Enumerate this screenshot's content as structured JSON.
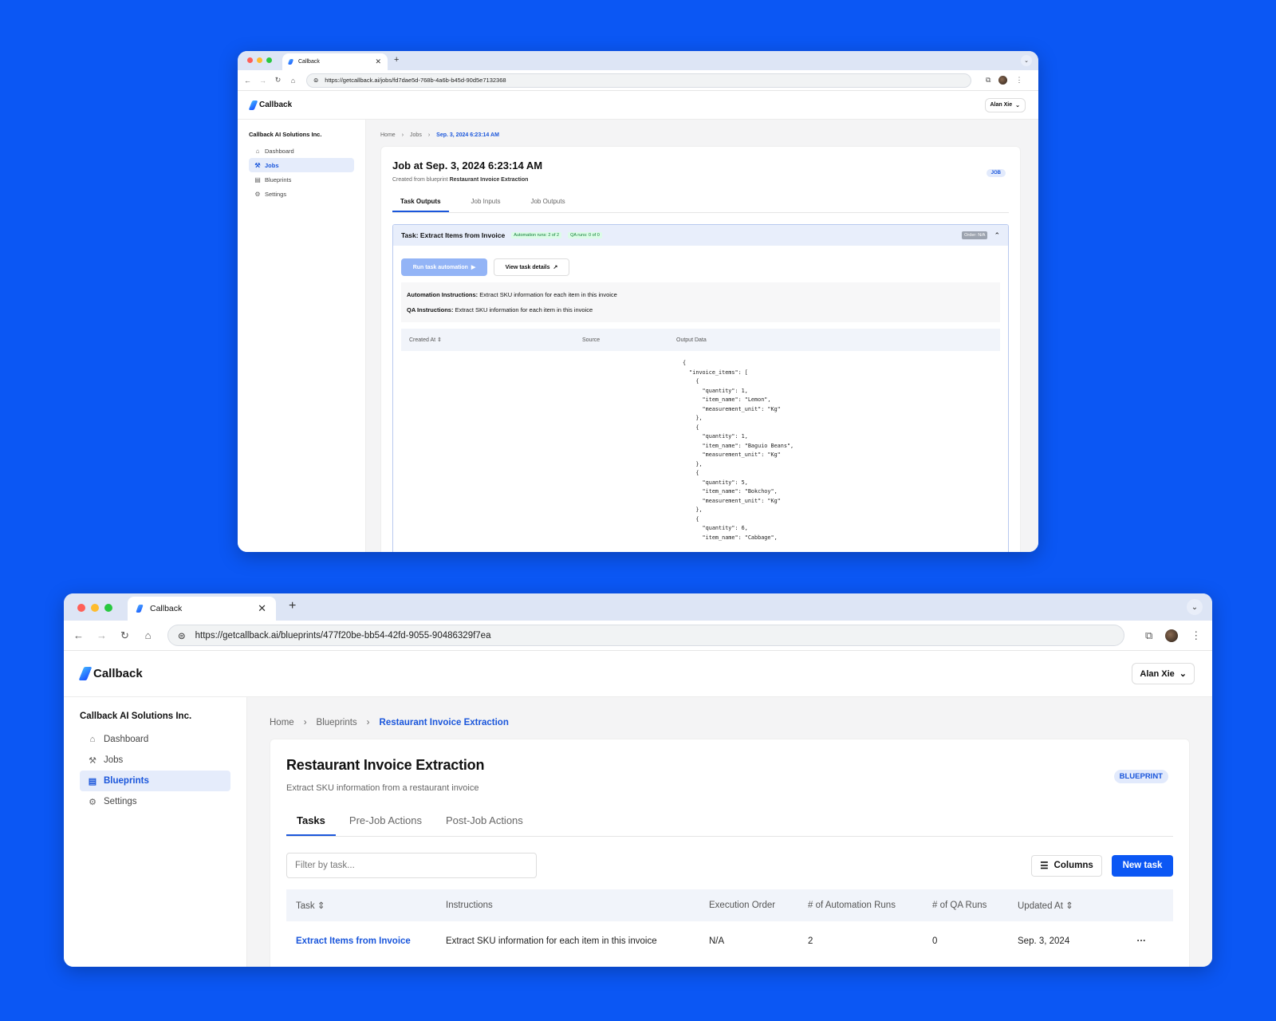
{
  "window1": {
    "tab_title": "Callback",
    "url": "https://getcallback.ai/jobs/fd7dae5d-768b-4a6b-b45d-90d5e7132368",
    "logo_text": "Callback",
    "user_name": "Alan Xie",
    "org_name": "Callback AI Solutions Inc.",
    "nav": [
      {
        "label": "Dashboard",
        "icon": "home-icon"
      },
      {
        "label": "Jobs",
        "icon": "hammer-icon",
        "active": true
      },
      {
        "label": "Blueprints",
        "icon": "blueprint-icon"
      },
      {
        "label": "Settings",
        "icon": "gear-icon"
      }
    ],
    "breadcrumbs": [
      "Home",
      "Jobs",
      "Sep. 3, 2024 6:23:14 AM"
    ],
    "title": "Job at Sep. 3, 2024 6:23:14 AM",
    "subtitle_prefix": "Created from blueprint",
    "subtitle_blueprint": "Restaurant Invoice Extraction",
    "badge": "JOB",
    "tabs": [
      "Task Outputs",
      "Job Inputs",
      "Job Outputs"
    ],
    "task": {
      "name": "Task: Extract Items from Invoice",
      "automation_runs": "Automation runs: 2 of 2",
      "qa_runs": "QA runs: 0 of 0",
      "order": "Order: N/A",
      "run_button": "Run task automation",
      "details_button": "View task details",
      "automation_label": "Automation Instructions:",
      "automation_text": "Extract SKU information for each item in this invoice",
      "qa_label": "QA Instructions:",
      "qa_text": "Extract SKU information for each item in this invoice",
      "columns": [
        "Created At",
        "Source",
        "Output Data"
      ],
      "output_json": "{\n  \"invoice_items\": [\n    {\n      \"quantity\": 1,\n      \"item_name\": \"Lemon\",\n      \"measurement_unit\": \"Kg\"\n    },\n    {\n      \"quantity\": 1,\n      \"item_name\": \"Baguio Beans\",\n      \"measurement_unit\": \"Kg\"\n    },\n    {\n      \"quantity\": 5,\n      \"item_name\": \"Bokchoy\",\n      \"measurement_unit\": \"Kg\"\n    },\n    {\n      \"quantity\": 6,\n      \"item_name\": \"Cabbage\","
    }
  },
  "window2": {
    "tab_title": "Callback",
    "url": "https://getcallback.ai/blueprints/477f20be-bb54-42fd-9055-90486329f7ea",
    "logo_text": "Callback",
    "user_name": "Alan Xie",
    "org_name": "Callback AI Solutions Inc.",
    "nav": [
      {
        "label": "Dashboard",
        "icon": "home-icon"
      },
      {
        "label": "Jobs",
        "icon": "hammer-icon"
      },
      {
        "label": "Blueprints",
        "icon": "blueprint-icon",
        "active": true
      },
      {
        "label": "Settings",
        "icon": "gear-icon"
      }
    ],
    "breadcrumbs": [
      "Home",
      "Blueprints",
      "Restaurant Invoice Extraction"
    ],
    "title": "Restaurant Invoice Extraction",
    "subtitle": "Extract SKU information from a restaurant invoice",
    "badge": "BLUEPRINT",
    "tabs": [
      "Tasks",
      "Pre-Job Actions",
      "Post-Job Actions"
    ],
    "filter_placeholder": "Filter by task...",
    "columns_button": "Columns",
    "new_task_button": "New task",
    "table": {
      "columns": [
        "Task",
        "Instructions",
        "Execution Order",
        "# of Automation Runs",
        "# of QA Runs",
        "Updated At"
      ],
      "rows": [
        {
          "task": "Extract Items from Invoice",
          "instructions": "Extract SKU information for each item in this invoice",
          "execution_order": "N/A",
          "automation_runs": "2",
          "qa_runs": "0",
          "updated_at": "Sep. 3, 2024",
          "menu": "···"
        }
      ]
    }
  },
  "colors": {
    "background": "#0b57f4",
    "accent": "#1a56db",
    "active_nav_bg": "#e5ecfb"
  }
}
